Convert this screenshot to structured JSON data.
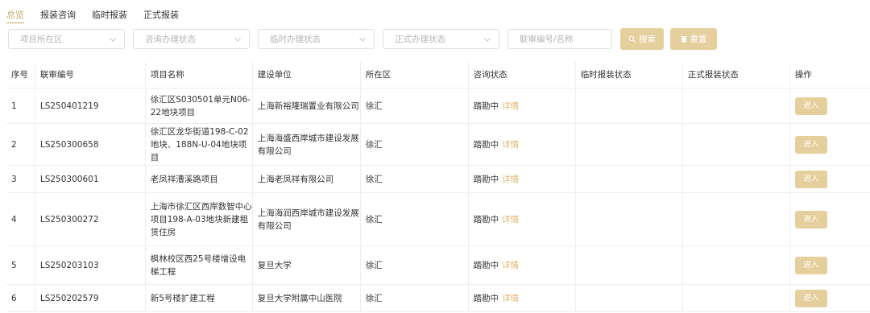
{
  "tabs": [
    {
      "label": "总览",
      "active": true
    },
    {
      "label": "报装咨询",
      "active": false
    },
    {
      "label": "临时报装",
      "active": false
    },
    {
      "label": "正式报装",
      "active": false
    }
  ],
  "filters": {
    "district_placeholder": "项目所在区",
    "consult_status_placeholder": "咨询办理状态",
    "temp_status_placeholder": "临时办理状态",
    "formal_status_placeholder": "正式办理状态",
    "search_placeholder": "联审编号/名称",
    "search_label": "搜索",
    "reset_label": "重置"
  },
  "table": {
    "headers": [
      "序号",
      "联审编号",
      "项目名称",
      "建设单位",
      "所在区",
      "咨询状态",
      "临时报装状态",
      "正式报装状态",
      "操作"
    ],
    "rows": [
      {
        "no": "1",
        "code": "LS250401219",
        "name": "徐汇区S030501单元N06-22地块项目",
        "unit": "上海新裕隆瑞置业有限公司",
        "district": "徐汇",
        "consult": "踏勘中",
        "detail": "详情",
        "temp": "",
        "formal": "",
        "action": "进入"
      },
      {
        "no": "2",
        "code": "LS250300658",
        "name": "徐汇区龙华街道198-C-02地块、188N-U-04地块项目",
        "unit": "上海海盛西岸城市建设发展有限公司",
        "district": "徐汇",
        "consult": "踏勘中",
        "detail": "详情",
        "temp": "",
        "formal": "",
        "action": "进入"
      },
      {
        "no": "3",
        "code": "LS250300601",
        "name": "老凤祥漕溪路项目",
        "unit": "上海老凤祥有限公司",
        "district": "徐汇",
        "consult": "踏勘中",
        "detail": "详情",
        "temp": "",
        "formal": "",
        "action": "进入"
      },
      {
        "no": "4",
        "code": "LS250300272",
        "name": "上海市徐汇区西岸数智中心项目198-A-03地块新建租赁住房",
        "unit": "上海海润西岸城市建设发展有限公司",
        "district": "徐汇",
        "consult": "踏勘中",
        "detail": "详情",
        "temp": "",
        "formal": "",
        "action": "进入"
      },
      {
        "no": "5",
        "code": "LS250203103",
        "name": "枫林校区西25号楼增设电梯工程",
        "unit": "复旦大学",
        "district": "徐汇",
        "consult": "踏勘中",
        "detail": "详情",
        "temp": "",
        "formal": "",
        "action": "进入"
      },
      {
        "no": "6",
        "code": "LS250202579",
        "name": "新5号楼扩建工程",
        "unit": "复旦大学附属中山医院",
        "district": "徐汇",
        "consult": "踏勘中",
        "detail": "详情",
        "temp": "",
        "formal": "",
        "action": "进入"
      }
    ]
  },
  "colors": {
    "accent": "#c9a96a",
    "button": "#e5cf9c",
    "detail": "#e0b770",
    "border": "#ebeef5"
  }
}
